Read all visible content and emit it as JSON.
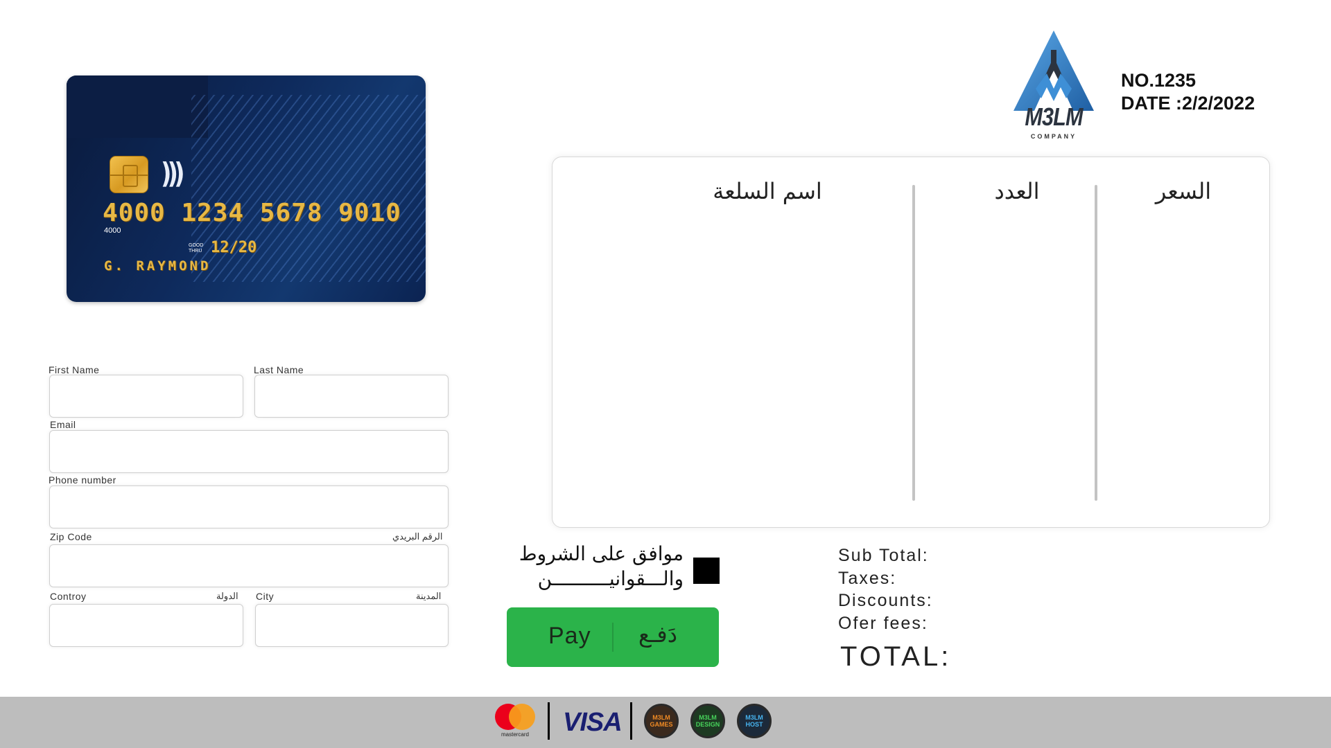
{
  "card": {
    "number": "4000 1234 5678 9010",
    "number_small": "4000",
    "good_thru": "GOOD\nTHRU",
    "expiry": "12/20",
    "holder": "G. RAYMOND",
    "contactless_icon": "contactless-icon",
    "colors": {
      "background": "#0e2a5c",
      "gold": "#e7b845"
    }
  },
  "form": {
    "first_name_label": "First Name",
    "last_name_label": "Last Name",
    "email_label": "Email",
    "phone_label": "Phone number",
    "zip_label": "Zip Code",
    "zip_label_ar": "الرقم البريدي",
    "country_label": "Controy",
    "country_label_ar": "الدولة",
    "city_label": "City",
    "city_label_ar": "المدينة",
    "first_name_value": "",
    "last_name_value": "",
    "email_value": "",
    "phone_value": "",
    "zip_value": "",
    "country_value": "",
    "city_value": ""
  },
  "invoice": {
    "number": "NO.1235",
    "date": "DATE :2/2/2022"
  },
  "logo": {
    "word": "M3LM",
    "company": "COMPANY",
    "colors": {
      "blue": "#3e8fd6",
      "dark": "#2c3440"
    }
  },
  "items_table": {
    "col_item_name": "اسم السلعة",
    "col_quantity": "العدد",
    "col_price": "السعر",
    "rows": []
  },
  "terms": {
    "text": "موافق على الشروط\nوالـــقوانيــــــــــن",
    "checked": true
  },
  "pay_button": {
    "label_en": "Pay",
    "label_ar": "دَفـع",
    "color": "#2bb34a"
  },
  "totals": {
    "sub_total": "Sub Total:",
    "taxes": "Taxes:",
    "discounts": "Discounts:",
    "offer_fees": "Ofer fees:",
    "total": "TOTAL:"
  },
  "footer": {
    "mastercard_text": "mastercard",
    "visa_text": "VISA",
    "badge_games": "M3LM\nGAMES",
    "badge_design": "M3LM\nDESIGN",
    "badge_host": "M3LM\nHOST",
    "colors": {
      "background": "#bdbdbd",
      "visa": "#1a1f71"
    }
  }
}
